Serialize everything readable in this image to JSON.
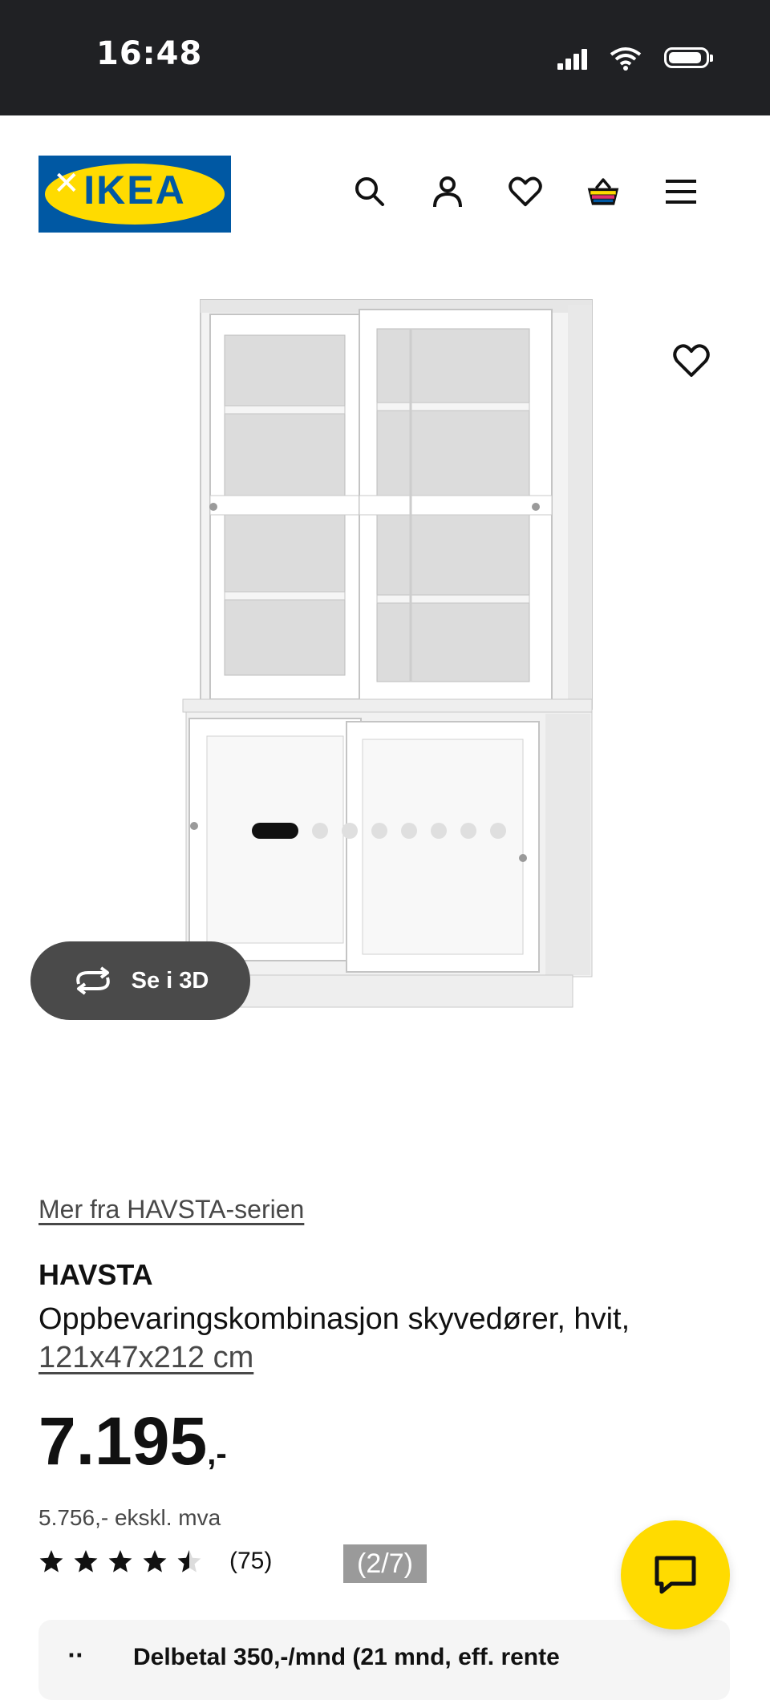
{
  "status_bar": {
    "time": "16:48"
  },
  "header": {
    "logo_text": "IKEA",
    "icons": [
      "search-icon",
      "user-icon",
      "heart-icon",
      "basket-icon",
      "menu-icon"
    ]
  },
  "gallery": {
    "view_3d_label": "Se i 3D",
    "image_count": 8,
    "active_image_index": 0
  },
  "product": {
    "series_link": "Mer fra HAVSTA-serien",
    "name": "HAVSTA",
    "description": "Oppbevaringskombinasjon skyvedører, hvit,",
    "size": "121x47x212 cm",
    "price_main": "7.195",
    "price_suffix": ",-",
    "price_ex_vat": "5.756,- ekskl. mva",
    "rating": 4.5,
    "review_count": "(75)",
    "page_badge": "(2/7)",
    "payment_text": "Delbetal 350,-/mnd (21 mnd, eff. rente"
  },
  "colors": {
    "ikea_blue": "#0058a3",
    "ikea_yellow": "#ffdb00",
    "status_bar_bg": "#202124",
    "view_3d_bg": "#4a4a4a"
  }
}
